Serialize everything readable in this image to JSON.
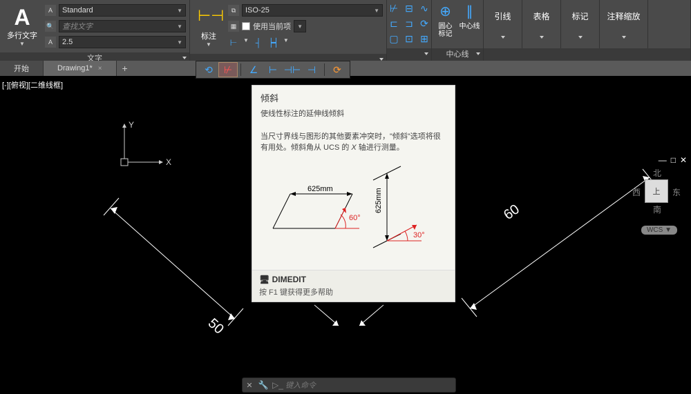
{
  "ribbon": {
    "text_panel": {
      "big_label": "多行文字",
      "style_dd": "Standard",
      "find_dd": "查找文字",
      "height_dd": "2.5",
      "title": "文字"
    },
    "dim_panel": {
      "big_label": "标注",
      "style_dd": "ISO-25",
      "use_current_label": "使用当前项",
      "title": ""
    },
    "centerline": {
      "item1": "圆心\n标记",
      "item2": "中心线",
      "title": "中心线"
    },
    "btns": {
      "b1": "引线",
      "b2": "表格",
      "b3": "标记",
      "b4": "注释缩放"
    }
  },
  "tabs": {
    "t1": "开始",
    "t2": "Drawing1*"
  },
  "viewport": {
    "label": "[-][俯视][二维线框]",
    "dim_left": "50",
    "dim_right": "60",
    "nav": {
      "n": "北",
      "s": "南",
      "e": "东",
      "w": "西",
      "top": "上"
    },
    "wcs": "WCS"
  },
  "tooltip": {
    "title": "倾斜",
    "subtitle": "使线性标注的延伸线倾斜",
    "body": "当尺寸界线与图形的其他要素冲突时，\"倾斜\"选项将很有用处。倾斜角从 UCS 的 X 轴进行测量。",
    "dim1": "625mm",
    "ang1": "60°",
    "dim2": "625mm",
    "ang2": "30°",
    "cmd": "DIMEDIT",
    "f1": "按 F1 键获得更多帮助"
  },
  "cmdline": {
    "placeholder": "键入命令"
  }
}
